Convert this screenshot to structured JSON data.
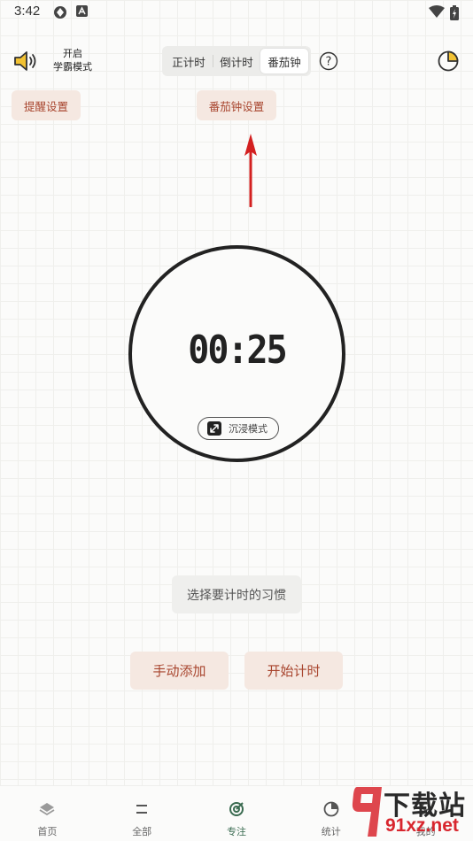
{
  "status_bar": {
    "time": "3:42"
  },
  "header": {
    "study_mode": {
      "line1": "开启",
      "line2": "学霸模式"
    },
    "segments": [
      {
        "label": "正计时",
        "active": false
      },
      {
        "label": "倒计时",
        "active": false
      },
      {
        "label": "番茄钟",
        "active": true
      }
    ],
    "help_symbol": "?"
  },
  "settings": {
    "reminder": "提醒设置",
    "pomodoro": "番茄钟设置"
  },
  "timer": {
    "value": "00:25",
    "immersive_label": "沉浸模式"
  },
  "habit_placeholder": "选择要计时的习惯",
  "actions": {
    "manual_add": "手动添加",
    "start": "开始计时"
  },
  "bottom_nav": [
    {
      "label": "首页",
      "icon": "layers-icon"
    },
    {
      "label": "全部",
      "icon": "list-icon"
    },
    {
      "label": "专注",
      "icon": "focus-target-icon",
      "active": true
    },
    {
      "label": "统计",
      "icon": "stats-icon"
    },
    {
      "label": "我的",
      "icon": "profile-icon"
    }
  ],
  "watermark": {
    "top": "下载站",
    "bottom": "91xz.net"
  },
  "colors": {
    "accent": "#a8452e",
    "chip_bg": "#f5e8e1",
    "active_nav": "#3a6b50",
    "arrow": "#d32020"
  }
}
